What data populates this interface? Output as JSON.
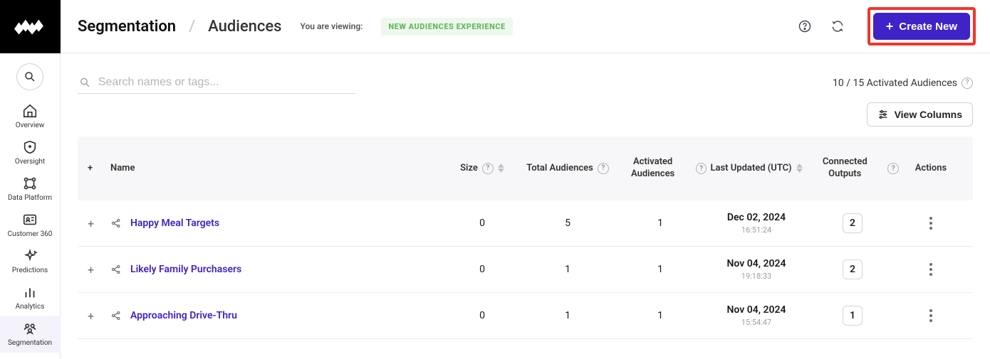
{
  "sidebar": {
    "items": [
      {
        "label": "Overview"
      },
      {
        "label": "Oversight"
      },
      {
        "label": "Data Platform"
      },
      {
        "label": "Customer 360"
      },
      {
        "label": "Predictions"
      },
      {
        "label": "Analytics"
      },
      {
        "label": "Segmentation"
      }
    ]
  },
  "header": {
    "crumb_root": "Segmentation",
    "crumb_current": "Audiences",
    "viewing_label": "You are viewing:",
    "badge": "NEW AUDIENCES EXPERIENCE",
    "create_label": "Create New"
  },
  "toolbar": {
    "search_placeholder": "Search names or tags...",
    "activated_count": "10 / 15 Activated Audiences",
    "view_columns_label": "View Columns"
  },
  "table": {
    "columns": {
      "name": "Name",
      "size": "Size",
      "total_audiences": "Total Audiences",
      "activated_audiences": "Activated Audiences",
      "last_updated": "Last Updated (UTC)",
      "connected_outputs": "Connected Outputs",
      "actions": "Actions"
    },
    "rows": [
      {
        "name": "Happy Meal Targets",
        "size": "0",
        "total": "5",
        "activated": "1",
        "date": "Dec 02, 2024",
        "time": "16:51:24",
        "outputs": "2"
      },
      {
        "name": "Likely Family Purchasers",
        "size": "0",
        "total": "1",
        "activated": "1",
        "date": "Nov 04, 2024",
        "time": "19:18:33",
        "outputs": "2"
      },
      {
        "name": "Approaching Drive-Thru",
        "size": "0",
        "total": "1",
        "activated": "1",
        "date": "Nov 04, 2024",
        "time": "15:54:47",
        "outputs": "1"
      }
    ]
  }
}
